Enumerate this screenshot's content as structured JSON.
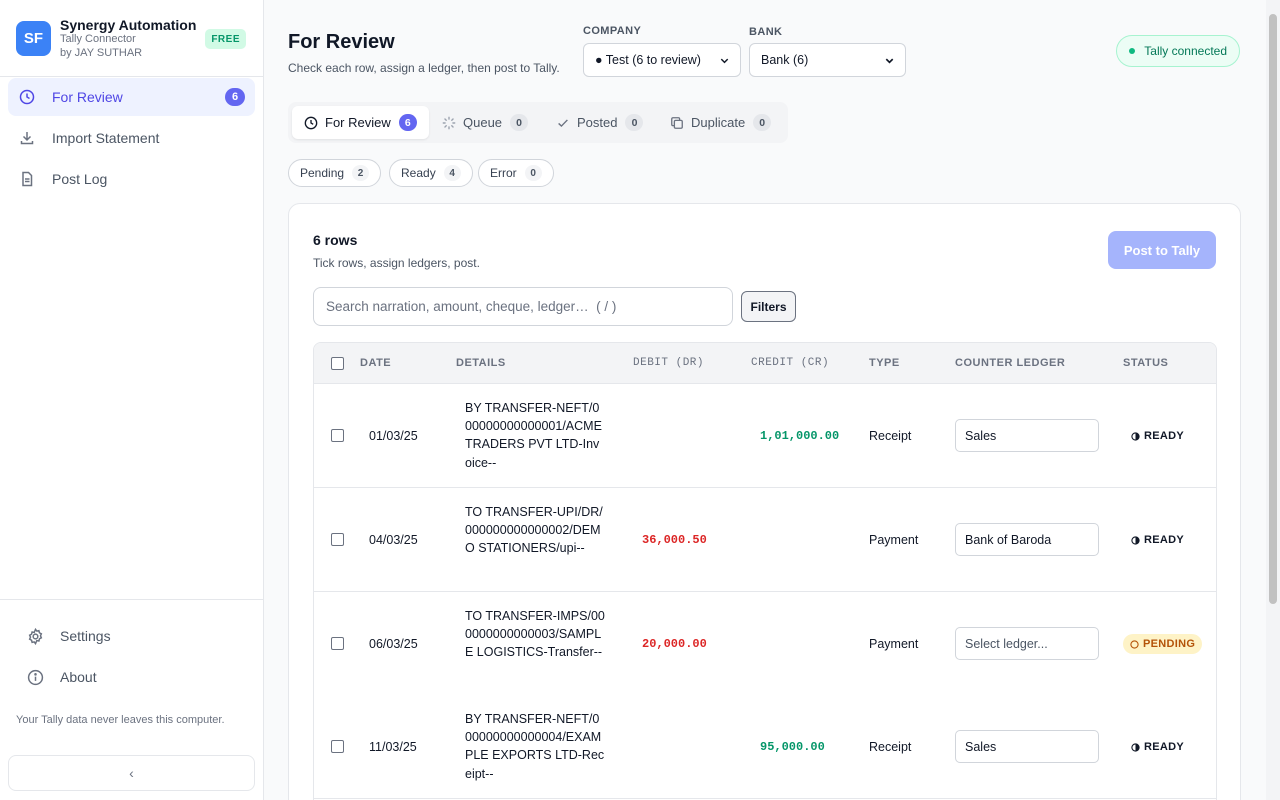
{
  "app": {
    "logo_initials": "SF",
    "name": "Synergy Automation",
    "subtitle": "Tally Connector",
    "author": "by JAY SUTHAR",
    "plan_badge": "FREE"
  },
  "sidebar": {
    "items": [
      {
        "label": "For Review",
        "icon": "clock-icon",
        "count": "6",
        "active": true
      },
      {
        "label": "Import Statement",
        "icon": "download-icon"
      },
      {
        "label": "Post Log",
        "icon": "document-icon"
      }
    ],
    "bottom_items": [
      {
        "label": "Settings",
        "icon": "gear-icon"
      },
      {
        "label": "About",
        "icon": "info-icon"
      }
    ],
    "privacy_note": "Your Tally data never leaves this computer.",
    "collapse_label": "‹"
  },
  "header": {
    "title": "For Review",
    "subtitle": "Check each row, assign a ledger, then post to Tally.",
    "company_label": "COMPANY",
    "company_value": "● Test (6 to review)",
    "bank_label": "BANK",
    "bank_value": "Bank (6)",
    "connection_status": "Tally connected"
  },
  "tabs": [
    {
      "label": "For Review",
      "count": "6",
      "icon": "clock-icon",
      "active": true
    },
    {
      "label": "Queue",
      "count": "0",
      "icon": "spinner-icon"
    },
    {
      "label": "Posted",
      "count": "0",
      "icon": "check-icon"
    },
    {
      "label": "Duplicate",
      "count": "0",
      "icon": "copy-icon"
    }
  ],
  "status_filters": [
    {
      "label": "Pending",
      "count": "2"
    },
    {
      "label": "Ready",
      "count": "4"
    },
    {
      "label": "Error",
      "count": "0"
    }
  ],
  "card": {
    "rows_title": "6 rows",
    "rows_subtitle": "Tick rows, assign ledgers, post.",
    "post_button": "Post to Tally",
    "search_placeholder": "Search narration, amount, cheque, ledger…  ( / )",
    "filters_button": "Filters"
  },
  "table": {
    "columns": [
      "DATE",
      "DETAILS",
      "DEBIT (DR)",
      "CREDIT (CR)",
      "TYPE",
      "COUNTER LEDGER",
      "STATUS"
    ],
    "rows": [
      {
        "date": "01/03/25",
        "details": "BY TRANSFER-NEFT/000000000000001/ACME TRADERS PVT LTD-Invoice--",
        "debit": "",
        "credit": "1,01,000.00",
        "type": "Receipt",
        "ledger": "Sales",
        "ledger_placeholder": "",
        "status": "READY"
      },
      {
        "date": "04/03/25",
        "details": "TO TRANSFER-UPI/DR/000000000000002/DEMO STATIONERS/upi--",
        "debit": "36,000.50",
        "credit": "",
        "type": "Payment",
        "ledger": "Bank of Baroda",
        "ledger_placeholder": "",
        "status": "READY"
      },
      {
        "date": "06/03/25",
        "details": "TO TRANSFER-IMPS/000000000000003/SAMPLE LOGISTICS-Transfer--",
        "debit": "20,000.00",
        "credit": "",
        "type": "Payment",
        "ledger": "",
        "ledger_placeholder": "Select ledger...",
        "status": "PENDING"
      },
      {
        "date": "11/03/25",
        "details": "BY TRANSFER-NEFT/000000000000004/EXAMPLE EXPORTS LTD-Receipt--",
        "debit": "",
        "credit": "95,000.00",
        "type": "Receipt",
        "ledger": "Sales",
        "ledger_placeholder": "",
        "status": "READY"
      }
    ]
  },
  "colors": {
    "accent": "#6366f1",
    "debit": "#dc2626",
    "credit": "#059669",
    "connected": "#10b981"
  }
}
